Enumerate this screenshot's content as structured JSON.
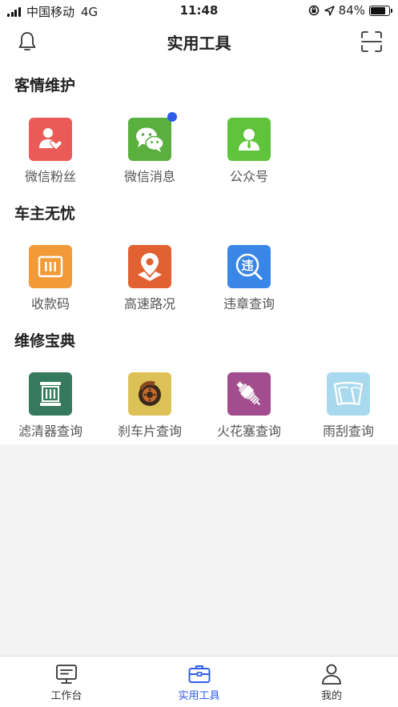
{
  "status_bar": {
    "carrier": "中国移动",
    "network": "4G",
    "time": "11:48",
    "battery_text": "84%",
    "battery_level": 0.84
  },
  "nav": {
    "title": "实用工具",
    "left_icon": "bell-icon",
    "right_icon": "scan-icon"
  },
  "sections": [
    {
      "title": "客情维护",
      "items": [
        {
          "label": "微信粉丝",
          "color": "#ea5b57",
          "icon": "fans-icon",
          "badge": false
        },
        {
          "label": "微信消息",
          "color": "#5ab03f",
          "icon": "wechat-icon",
          "badge": true
        },
        {
          "label": "公众号",
          "color": "#5fc33c",
          "icon": "official-account-icon",
          "badge": false
        }
      ]
    },
    {
      "title": "车主无忧",
      "items": [
        {
          "label": "收款码",
          "color": "#f29a38",
          "icon": "payment-code-icon"
        },
        {
          "label": "高速路况",
          "color": "#e26132",
          "icon": "map-pin-icon"
        },
        {
          "label": "违章查询",
          "color": "#3a86e6",
          "icon": "violation-search-icon",
          "icon_text": "违"
        }
      ]
    },
    {
      "title": "维修宝典",
      "items": [
        {
          "label": "滤清器查询",
          "color": "#357a5e",
          "icon": "filter-icon"
        },
        {
          "label": "刹车片查询",
          "color": "#dcc156",
          "icon": "brake-pad-icon"
        },
        {
          "label": "火花塞查询",
          "color": "#a24d8e",
          "icon": "spark-plug-icon"
        },
        {
          "label": "雨刮查询",
          "color": "#a9d9ee",
          "icon": "wiper-icon"
        }
      ]
    }
  ],
  "tabs": [
    {
      "label": "工作台",
      "icon": "workbench-icon",
      "active": false
    },
    {
      "label": "实用工具",
      "icon": "toolbox-icon",
      "active": true
    },
    {
      "label": "我的",
      "icon": "user-icon",
      "active": false
    }
  ],
  "colors": {
    "accent": "#2e5bea",
    "badge": "#2e5bea",
    "page_background": "#f3f3f3"
  }
}
